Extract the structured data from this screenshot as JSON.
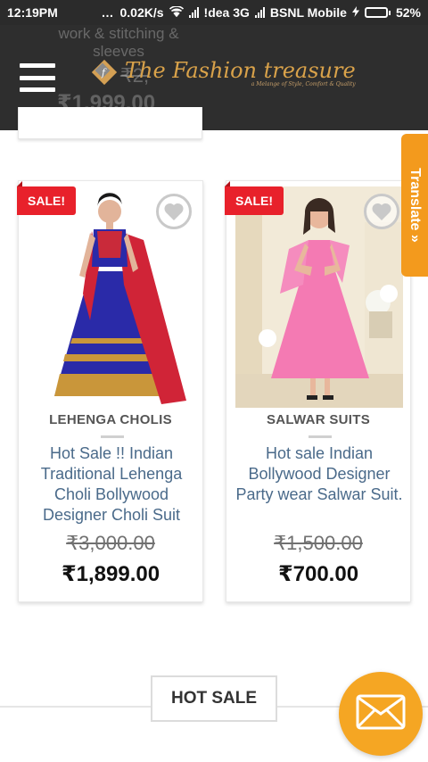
{
  "status_bar": {
    "time": "12:19PM",
    "speed": "0.02K/s",
    "carrier1": "!dea 3G",
    "carrier2": "BSNL Mobile",
    "battery": "52%",
    "battery_level": 0.52
  },
  "header": {
    "brand": "The Fashion treasure",
    "tagline": "a Melange of Style, Comfort & Quality",
    "ghost_text": "work & stitching & sleeves",
    "ghost_old_price": "₹2,",
    "ghost_new_price": "₹1,999.00"
  },
  "translate_tab": {
    "label": "Translate »"
  },
  "products": [
    {
      "sale_badge": "SALE!",
      "category": "LEHENGA CHOLIS",
      "title": "Hot Sale !! Indian Traditional Lehenga Choli Bollywood Designer Choli Suit",
      "old_price": "₹3,000.00",
      "new_price": "₹1,899.00"
    },
    {
      "sale_badge": "SALE!",
      "category": "SALWAR SUITS",
      "title": "Hot sale Indian Bollywood Designer Party wear Salwar Suit.",
      "old_price": "₹1,500.00",
      "new_price": "₹700.00"
    }
  ],
  "hot_sale": {
    "label": "HOT SALE"
  },
  "colors": {
    "header_bg": "#2e2e2e",
    "sale_red": "#e8212b",
    "translate_orange": "#f39a1d",
    "mail_orange": "#f5a623",
    "title_blue": "#4a6a8a"
  }
}
